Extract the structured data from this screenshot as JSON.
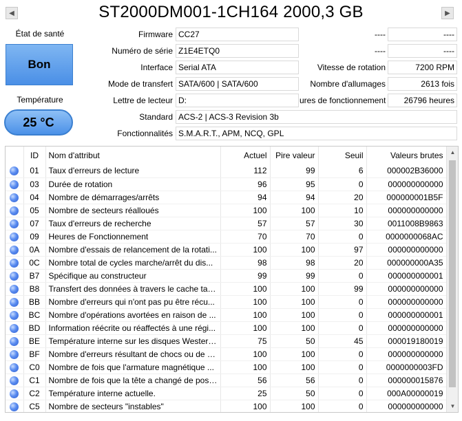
{
  "title": "ST2000DM001-1CH164 2000,3 GB",
  "nav": {
    "prev": "◀",
    "next": "▶"
  },
  "health": {
    "label": "État de santé",
    "value": "Bon"
  },
  "temperature": {
    "label": "Température",
    "value": "25 °C"
  },
  "info": {
    "firmware": {
      "label": "Firmware",
      "value": "CC27"
    },
    "serial": {
      "label": "Numéro de série",
      "value": "Z1E4ETQ0"
    },
    "interface": {
      "label": "Interface",
      "value": "Serial ATA"
    },
    "transfer": {
      "label": "Mode de transfert",
      "value": "SATA/600 | SATA/600"
    },
    "drive_letter": {
      "label": "Lettre de lecteur",
      "value": "D:"
    },
    "standard": {
      "label": "Standard",
      "value": "ACS-2 | ACS-3 Revision 3b"
    },
    "features": {
      "label": "Fonctionnalités",
      "value": "S.M.A.R.T., APM, NCQ, GPL"
    }
  },
  "right_info": {
    "row1": {
      "label": "----",
      "value": "----"
    },
    "row2": {
      "label": "----",
      "value": "----"
    },
    "rotation": {
      "label": "Vitesse de rotation",
      "value": "7200 RPM"
    },
    "power_count": {
      "label": "Nombre d'allumages",
      "value": "2613 fois"
    },
    "power_hours": {
      "label": "ures de fonctionnement",
      "value": "26796 heures"
    }
  },
  "table": {
    "headers": {
      "id": "ID",
      "name": "Nom d'attribut",
      "current": "Actuel",
      "worst": "Pire valeur",
      "threshold": "Seuil",
      "raw": "Valeurs brutes"
    },
    "rows": [
      {
        "id": "01",
        "name": "Taux d'erreurs de lecture",
        "current": "112",
        "worst": "99",
        "threshold": "6",
        "raw": "000002B36000"
      },
      {
        "id": "03",
        "name": "Durée de rotation",
        "current": "96",
        "worst": "95",
        "threshold": "0",
        "raw": "000000000000"
      },
      {
        "id": "04",
        "name": "Nombre de démarrages/arrêts",
        "current": "94",
        "worst": "94",
        "threshold": "20",
        "raw": "000000001B5F"
      },
      {
        "id": "05",
        "name": "Nombre de secteurs réalloués",
        "current": "100",
        "worst": "100",
        "threshold": "10",
        "raw": "000000000000"
      },
      {
        "id": "07",
        "name": "Taux d'erreurs de recherche",
        "current": "57",
        "worst": "57",
        "threshold": "30",
        "raw": "0011008B9863"
      },
      {
        "id": "09",
        "name": "Heures de Fonctionnement",
        "current": "70",
        "worst": "70",
        "threshold": "0",
        "raw": "0000000068AC"
      },
      {
        "id": "0A",
        "name": "Nombre d'essais de relancement de la rotati...",
        "current": "100",
        "worst": "100",
        "threshold": "97",
        "raw": "000000000000"
      },
      {
        "id": "0C",
        "name": "Nombre total de cycles marche/arrêt du dis...",
        "current": "98",
        "worst": "98",
        "threshold": "20",
        "raw": "000000000A35"
      },
      {
        "id": "B7",
        "name": "Spécifique au constructeur",
        "current": "99",
        "worst": "99",
        "threshold": "0",
        "raw": "000000000001"
      },
      {
        "id": "B8",
        "name": "Transfert des données à travers le cache tam...",
        "current": "100",
        "worst": "100",
        "threshold": "99",
        "raw": "000000000000"
      },
      {
        "id": "BB",
        "name": "Nombre d'erreurs qui n'ont pas pu être récu...",
        "current": "100",
        "worst": "100",
        "threshold": "0",
        "raw": "000000000000"
      },
      {
        "id": "BC",
        "name": "Nombre d'opérations avortées en raison de ...",
        "current": "100",
        "worst": "100",
        "threshold": "0",
        "raw": "000000000001"
      },
      {
        "id": "BD",
        "name": "Information réécrite ou réaffectés à une régi...",
        "current": "100",
        "worst": "100",
        "threshold": "0",
        "raw": "000000000000"
      },
      {
        "id": "BE",
        "name": "Température interne sur les disques Western ...",
        "current": "75",
        "worst": "50",
        "threshold": "45",
        "raw": "000019180019"
      },
      {
        "id": "BF",
        "name": "Nombre d'erreurs résultant de chocs ou de v...",
        "current": "100",
        "worst": "100",
        "threshold": "0",
        "raw": "000000000000"
      },
      {
        "id": "C0",
        "name": "Nombre de fois que l'armature magnétique ...",
        "current": "100",
        "worst": "100",
        "threshold": "0",
        "raw": "0000000003FD"
      },
      {
        "id": "C1",
        "name": "Nombre de fois que la tête a changé de posi...",
        "current": "56",
        "worst": "56",
        "threshold": "0",
        "raw": "000000015876"
      },
      {
        "id": "C2",
        "name": "Température interne actuelle.",
        "current": "25",
        "worst": "50",
        "threshold": "0",
        "raw": "000A00000019"
      },
      {
        "id": "C5",
        "name": "Nombre de secteurs \"instables\"",
        "current": "100",
        "worst": "100",
        "threshold": "0",
        "raw": "000000000000"
      }
    ]
  },
  "colors": {
    "health_good": "#4a8fe6",
    "status_dot": "#2f5fd0"
  },
  "icons": {
    "row_status": "blue-status-dot-icon",
    "prev": "left-arrow-icon",
    "next": "right-arrow-icon"
  }
}
